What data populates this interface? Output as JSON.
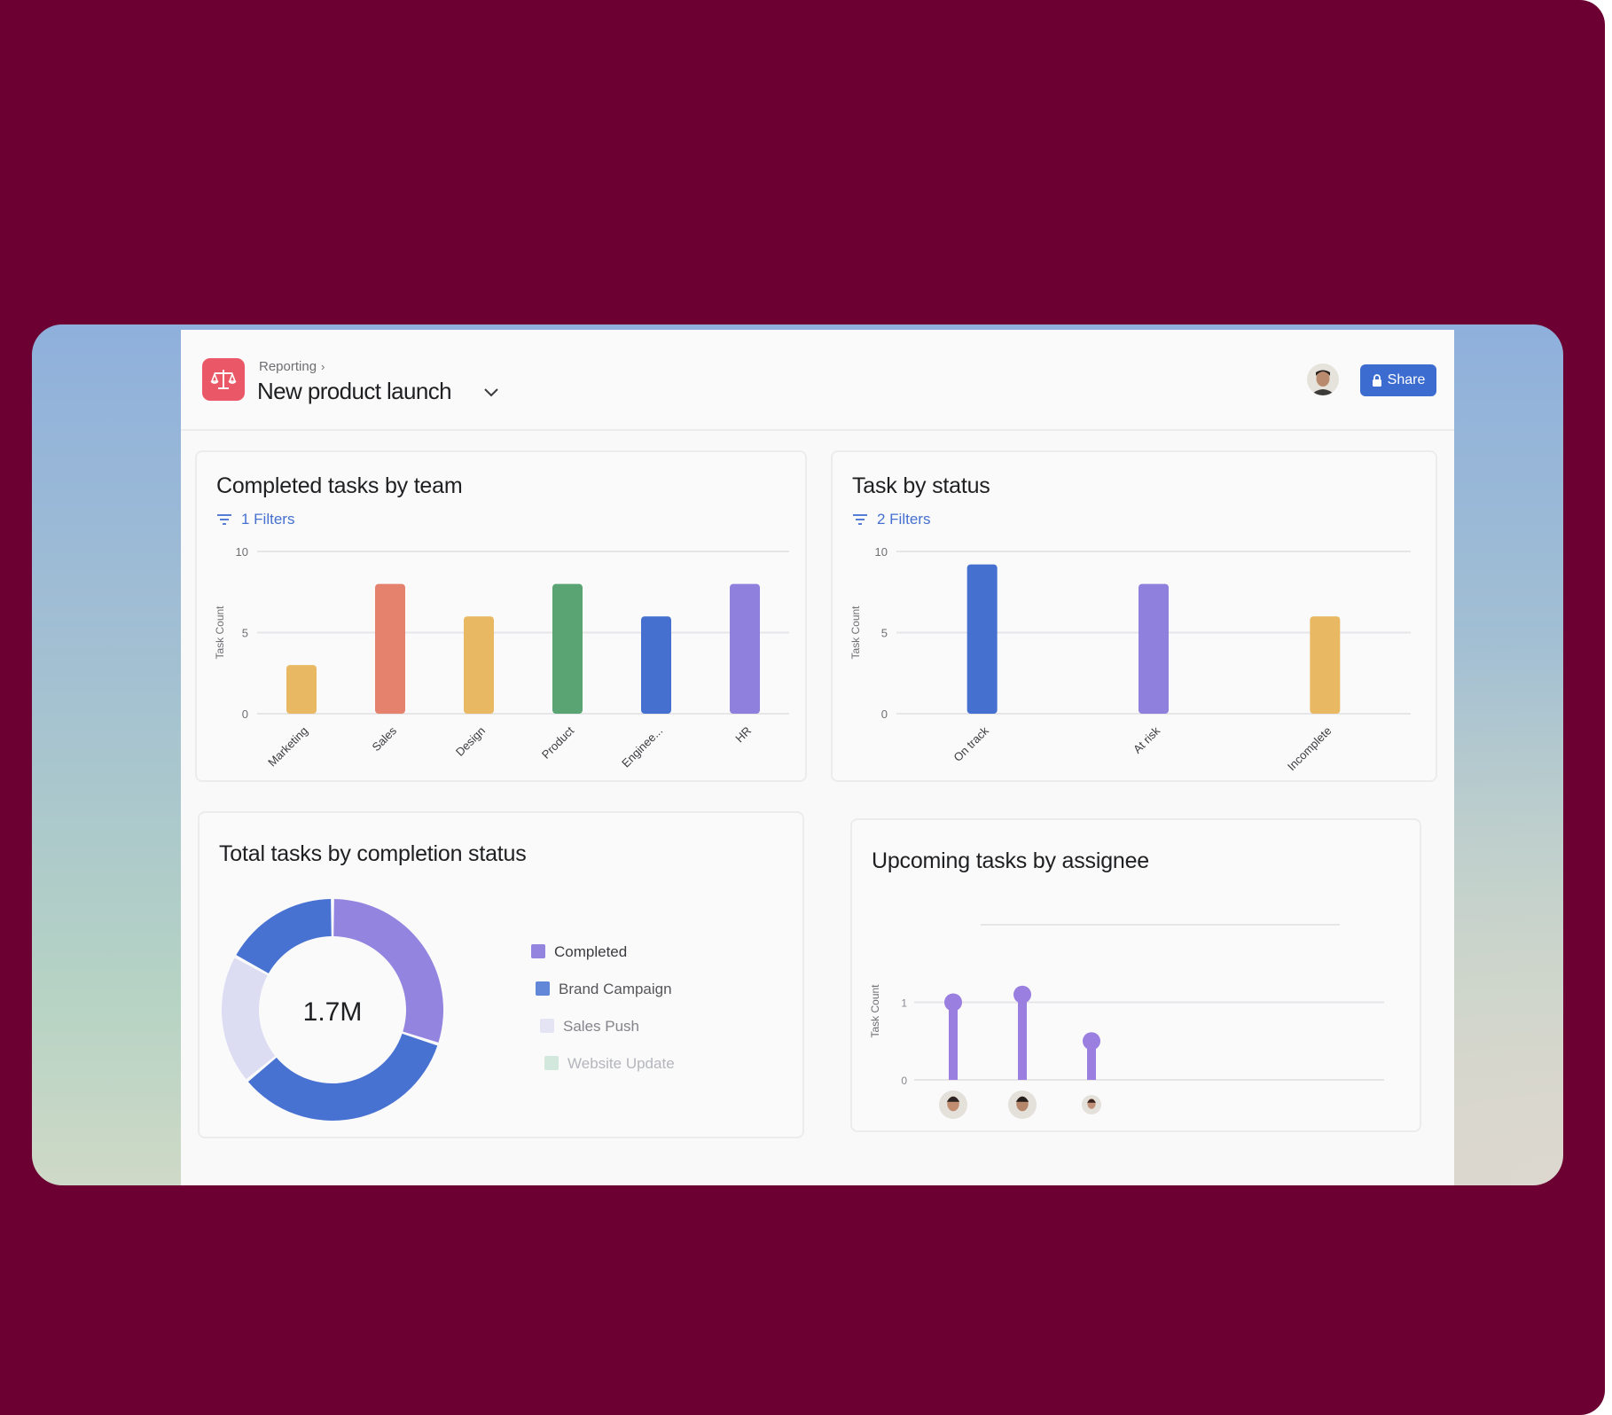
{
  "header": {
    "breadcrumb": "Reporting",
    "project_title": "New product launch",
    "share_label": "Share"
  },
  "cards": {
    "team": {
      "title": "Completed tasks by team",
      "filters": "1 Filters",
      "ylabel": "Task Count"
    },
    "status": {
      "title": "Task by status",
      "filters": "2 Filters",
      "ylabel": "Task Count"
    },
    "completion": {
      "title": "Total tasks by completion status",
      "center_value": "1.7M"
    },
    "assignee": {
      "title": "Upcoming tasks by assignee",
      "ylabel": "Task Count"
    }
  },
  "chart_data": [
    {
      "type": "bar",
      "title": "Completed tasks by team",
      "ylabel": "Task Count",
      "categories": [
        "Marketing",
        "Sales",
        "Design",
        "Product",
        "Enginee...",
        "HR"
      ],
      "values": [
        3,
        8,
        6,
        8,
        6,
        8
      ],
      "colors": [
        "#e8b862",
        "#e5826e",
        "#e8b862",
        "#5aa474",
        "#4570d0",
        "#9080de"
      ],
      "yticks": [
        "0",
        "5",
        "10"
      ],
      "ylim": [
        0,
        10
      ]
    },
    {
      "type": "bar",
      "title": "Task by status",
      "ylabel": "Task Count",
      "categories": [
        "On track",
        "At risk",
        "Incomplete"
      ],
      "values": [
        9.2,
        8,
        6
      ],
      "colors": [
        "#4570d0",
        "#9080de",
        "#e8b862"
      ],
      "yticks": [
        "0",
        "5",
        "10"
      ],
      "ylim": [
        0,
        10
      ]
    },
    {
      "type": "pie",
      "title": "Total tasks by completion status",
      "center_label": "1.7M",
      "labels": [
        "Completed",
        "Brand Campaign",
        "Sales Push",
        "Website Update"
      ],
      "values": [
        30,
        34,
        19,
        17
      ],
      "colors": [
        "#9384e0",
        "#4872d2",
        "#dcdcf3",
        "#4872d2"
      ],
      "legend_colors": [
        "#9384e0",
        "#6286d8",
        "#e4e4f4",
        "#d2e8dc"
      ],
      "legend_text_colors": [
        "#3c3c40",
        "#56565a",
        "#84848a",
        "#b4b6bc"
      ]
    },
    {
      "type": "bar",
      "title": "Upcoming tasks by assignee",
      "ylabel": "Task Count",
      "categories": [
        "assignee 1",
        "assignee 2",
        "assignee 3"
      ],
      "values": [
        1,
        1.1,
        0.5
      ],
      "color": "#9a7ee0",
      "yticks": [
        "0",
        "1"
      ],
      "ylim": [
        0,
        2
      ]
    }
  ]
}
